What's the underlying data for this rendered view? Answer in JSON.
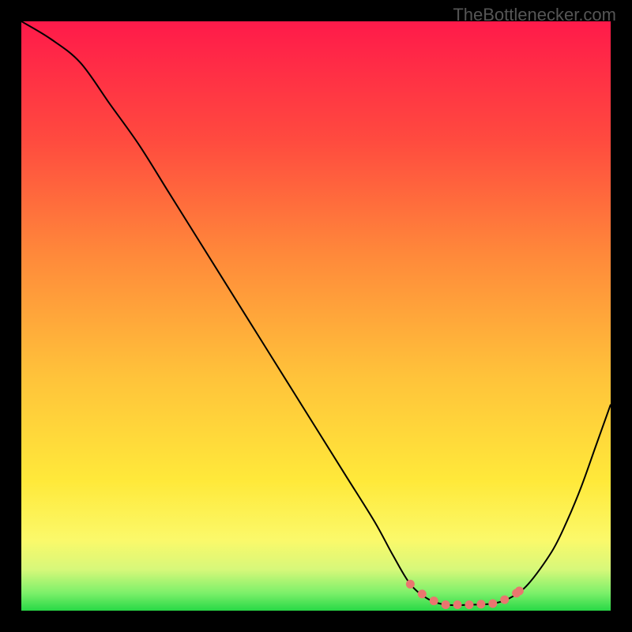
{
  "watermark": "TheBottlenecker.com",
  "chart_data": {
    "type": "line",
    "title": "",
    "xlabel": "",
    "ylabel": "",
    "x_range": [
      0,
      100
    ],
    "y_range": [
      0,
      100
    ],
    "curve": [
      {
        "x": 0.0,
        "y": 100.0
      },
      {
        "x": 5.0,
        "y": 97.0
      },
      {
        "x": 10.0,
        "y": 93.0
      },
      {
        "x": 15.0,
        "y": 86.0
      },
      {
        "x": 20.0,
        "y": 79.0
      },
      {
        "x": 25.0,
        "y": 71.0
      },
      {
        "x": 30.0,
        "y": 63.0
      },
      {
        "x": 35.0,
        "y": 55.0
      },
      {
        "x": 40.0,
        "y": 47.0
      },
      {
        "x": 45.0,
        "y": 39.0
      },
      {
        "x": 50.0,
        "y": 31.0
      },
      {
        "x": 55.0,
        "y": 23.0
      },
      {
        "x": 60.0,
        "y": 15.0
      },
      {
        "x": 63.0,
        "y": 9.5
      },
      {
        "x": 66.0,
        "y": 4.5
      },
      {
        "x": 69.0,
        "y": 2.0
      },
      {
        "x": 72.0,
        "y": 1.0
      },
      {
        "x": 76.0,
        "y": 1.0
      },
      {
        "x": 80.0,
        "y": 1.2
      },
      {
        "x": 83.0,
        "y": 2.2
      },
      {
        "x": 86.0,
        "y": 4.5
      },
      {
        "x": 90.0,
        "y": 10.0
      },
      {
        "x": 92.5,
        "y": 15.0
      },
      {
        "x": 95.0,
        "y": 21.0
      },
      {
        "x": 97.5,
        "y": 28.0
      },
      {
        "x": 100.0,
        "y": 35.0
      }
    ],
    "optimal_markers_x": [
      66,
      68,
      70,
      72,
      74,
      76,
      78,
      80,
      82,
      84,
      84.5
    ],
    "gradient_stops": [
      {
        "offset": 0,
        "color": "#ff1a4a"
      },
      {
        "offset": 20,
        "color": "#ff4a3f"
      },
      {
        "offset": 40,
        "color": "#ff8a3a"
      },
      {
        "offset": 60,
        "color": "#ffc23a"
      },
      {
        "offset": 78,
        "color": "#ffe93a"
      },
      {
        "offset": 88,
        "color": "#fbf96a"
      },
      {
        "offset": 93,
        "color": "#d7f87a"
      },
      {
        "offset": 97,
        "color": "#7cf06a"
      },
      {
        "offset": 100,
        "color": "#28d846"
      }
    ],
    "colors": {
      "curve": "#000000",
      "marker": "#e9766f",
      "background": "#000000"
    }
  }
}
